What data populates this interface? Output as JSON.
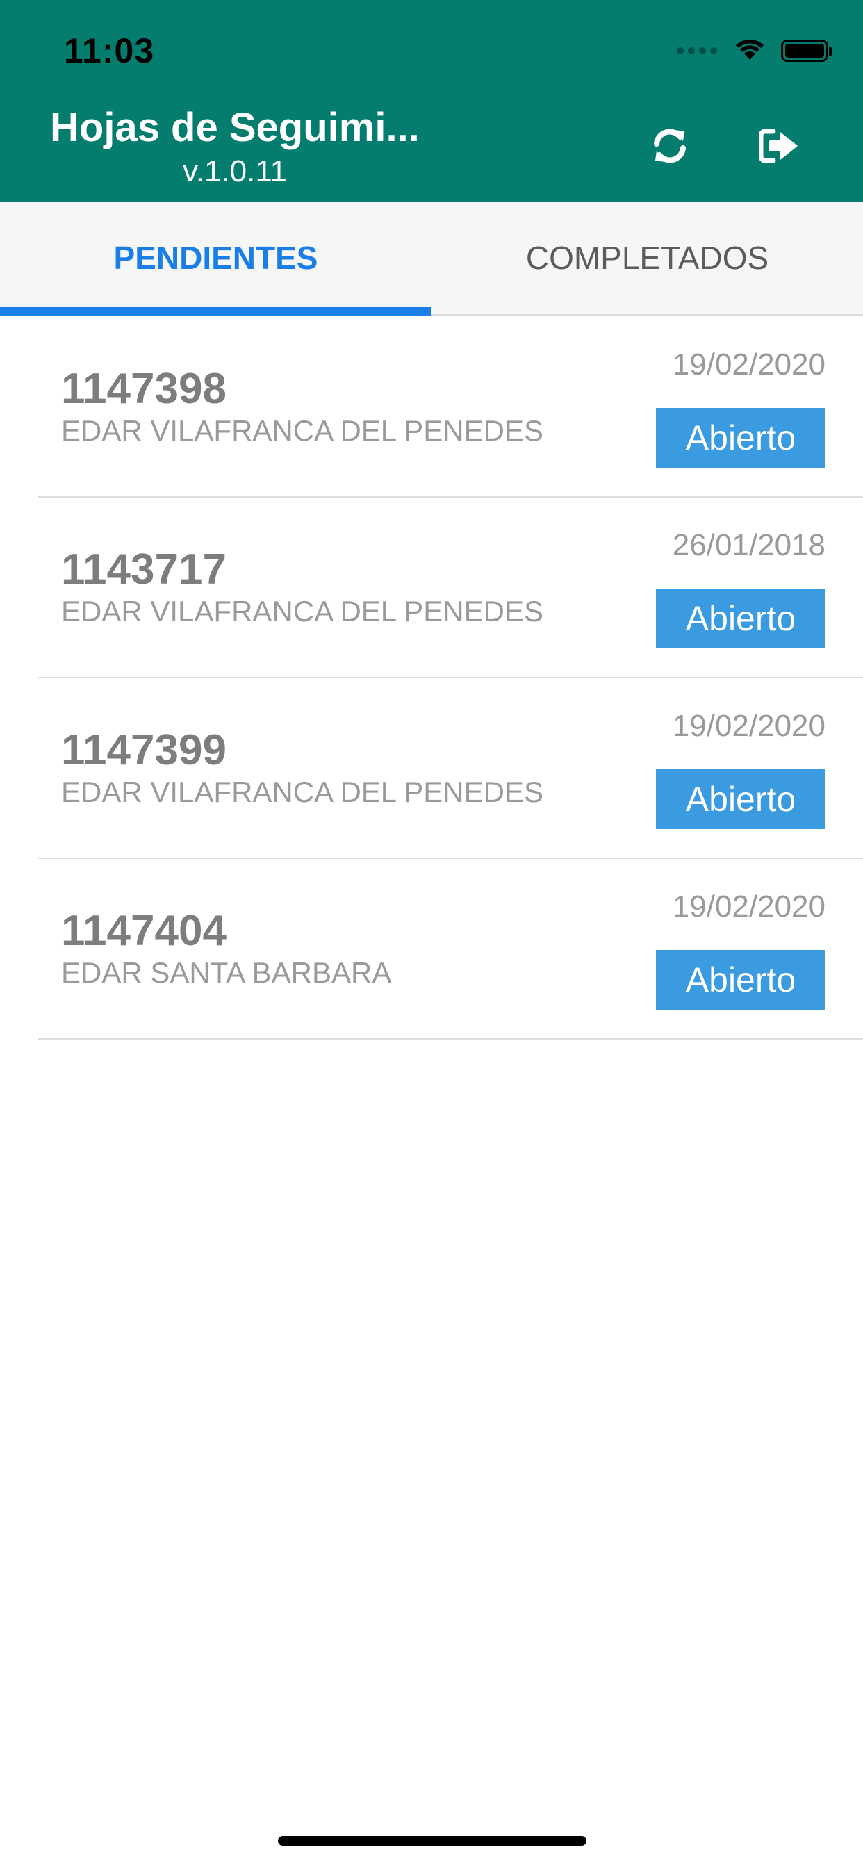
{
  "status_bar": {
    "time": "11:03"
  },
  "header": {
    "title": "Hojas de Seguimi...",
    "version": "v.1.0.11",
    "background_color": "#047d6f",
    "actions": [
      {
        "icon": "refresh-icon"
      },
      {
        "icon": "logout-icon"
      }
    ]
  },
  "tabs": [
    {
      "label": "PENDIENTES",
      "active": true
    },
    {
      "label": "COMPLETADOS",
      "active": false
    }
  ],
  "accent_color": "#1a7ee8",
  "badge_color": "#3a9be0",
  "items": [
    {
      "id": "1147398",
      "location": "EDAR VILAFRANCA DEL PENEDES",
      "date": "19/02/2020",
      "status": "Abierto"
    },
    {
      "id": "1143717",
      "location": "EDAR VILAFRANCA DEL PENEDES",
      "date": "26/01/2018",
      "status": "Abierto"
    },
    {
      "id": "1147399",
      "location": "EDAR VILAFRANCA DEL PENEDES",
      "date": "19/02/2020",
      "status": "Abierto"
    },
    {
      "id": "1147404",
      "location": "EDAR SANTA BARBARA",
      "date": "19/02/2020",
      "status": "Abierto"
    }
  ]
}
